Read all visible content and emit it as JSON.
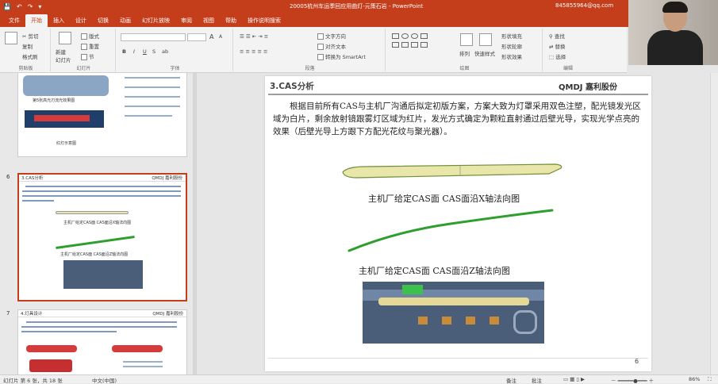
{
  "window": {
    "title": "20005杭州车运季回应用曲灯-元策石岩 - PowerPoint",
    "account": "845855964@qq.com"
  },
  "quick_access": [
    "💾",
    "↶",
    "↷",
    "▾"
  ],
  "tabs": [
    "文件",
    "开始",
    "插入",
    "设计",
    "切换",
    "动画",
    "幻灯片放映",
    "审阅",
    "视图",
    "帮助",
    "操作说明搜索"
  ],
  "active_tab": "开始",
  "ribbon": {
    "clipboard": {
      "label": "剪贴板",
      "cut": "✂ 剪切",
      "copy": "复制",
      "format": "格式刷"
    },
    "slides": {
      "label": "幻灯片",
      "new": "新建\n幻灯片",
      "layout": "版式",
      "reset": "重置",
      "section": "节"
    },
    "font": {
      "label": "字体",
      "bold": "B",
      "italic": "I",
      "underline": "U",
      "strike": "S",
      "shadow": "ab",
      "size_up": "A",
      "size_down": "A"
    },
    "paragraph": {
      "label": "段落",
      "direction": "文字方向",
      "align": "对齐文本",
      "smartart": "转换为 SmartArt"
    },
    "drawing": {
      "label": "绘图",
      "arrange": "排列",
      "quick_styles": "快速样式",
      "fill": "形状填充",
      "outline": "形状轮廓",
      "effects": "形状效果"
    },
    "editing": {
      "label": "编辑",
      "find": "查找",
      "replace": "替换",
      "select": "选择"
    }
  },
  "thumbnails": {
    "slide5": {
      "caption1": "第5张高光刃流光效果图",
      "caption2": "红灯示意图"
    },
    "slide6": {
      "number": "6",
      "title": "3.CAS分析",
      "logo": "QMDJ 嘉利股份",
      "cap1": "主机厂给定CAS面 CAS面沿X轴法向图",
      "cap2": "主机厂给定CAS面 CAS面沿Z轴法向图"
    },
    "slide7": {
      "number": "7",
      "title": "4.灯具设计",
      "logo": "QMDJ 嘉利股份"
    }
  },
  "slide": {
    "title": "3.CAS分析",
    "logo": "QMDJ 嘉利股份",
    "body": "根据目前所有CAS与主机厂沟通后拟定初版方案，方案大致为灯罩采用双色注塑，配光镜发光区域为白片，剩余放射镜跟雾灯区域为红片，发光方式确定为颗粒直射通过后壁光导，实现光学点亮的效果（后壁光导上方跟下方配光花纹与聚光器）。",
    "caption1": "主机厂给定CAS面 CAS面沿X轴法向图",
    "caption2": "主机厂给定CAS面 CAS面沿Z轴法向图",
    "page_number": "6"
  },
  "statusbar": {
    "slide_info": "幻灯片 第 6 张，共 18 张",
    "language": "中文(中国)",
    "notes": "备注",
    "comments": "批注",
    "zoom": "86%"
  },
  "colors": {
    "accent": "#c43e1c",
    "yellow_part": "#e8e6a8",
    "green_part": "#2e9e2e"
  }
}
